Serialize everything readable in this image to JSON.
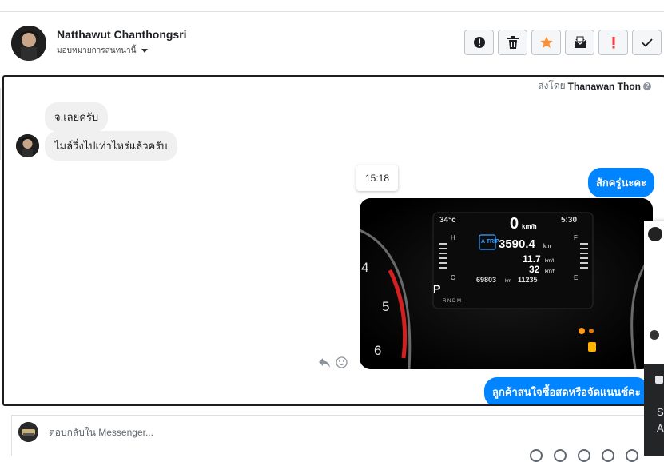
{
  "header": {
    "contact_name": "Natthawut Chanthongsri",
    "assign_label": "มอบหมายการสนทนานี้"
  },
  "thread": {
    "sent_by_prefix": "ส่งโดย",
    "sent_by_name": "Thanawan Thon",
    "messages_in": [
      "จ.เลยครับ",
      "ไมล์วิ่งไปเท่าไหร่แล้วครับ"
    ],
    "messages_out": [
      "สักครู่นะคะ",
      "ลูกค้าสนใจซื้อสดหรือจัดแนนซ์คะ"
    ],
    "timestamp": "15:18"
  },
  "dashboard": {
    "temp": "34°c",
    "speed": "0",
    "speed_unit": "km/h",
    "clock": "5:30",
    "trip_label": "A TRIP",
    "trip_km": "3590.4",
    "trip_unit": "km",
    "economy": "11.7",
    "economy_unit": "km/l",
    "avg_speed": "32",
    "avg_speed_unit": "km/h",
    "odometer": "69803",
    "odometer_unit": "km",
    "range": "11235",
    "gear": "P",
    "gear_list": "R N D M",
    "gauge_numbers": [
      "4",
      "5",
      "6"
    ]
  },
  "reply": {
    "placeholder": "ตอบกลับใน Messenger..."
  },
  "popup": {
    "line1": "S",
    "line2": "A"
  },
  "colors": {
    "messenger_blue": "#0084ff",
    "star_orange": "#f7923a",
    "alert_red": "#fa383e"
  }
}
